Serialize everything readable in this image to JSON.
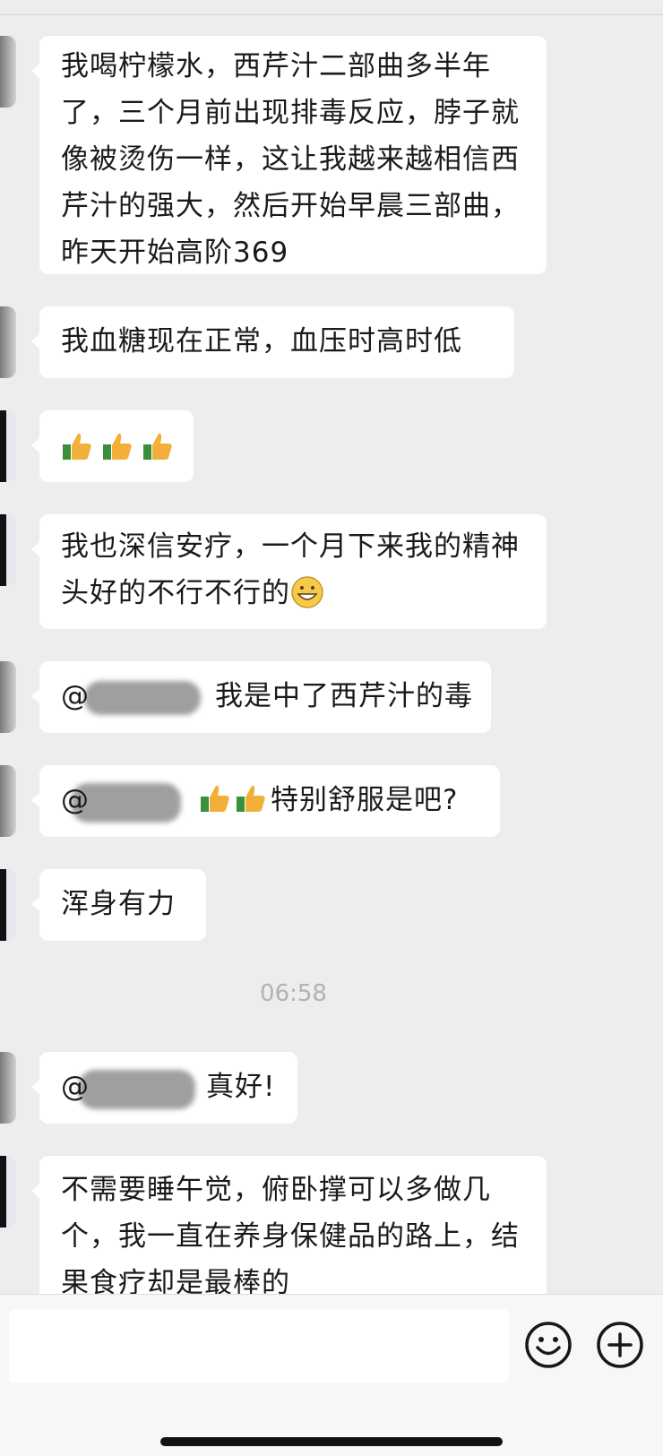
{
  "chat": {
    "messages": [
      {
        "text": "我喝柠檬水，西芹汁二部曲多半年了，三个月前出现排毒反应，脖子就像被烫伤一样，这让我越来越相信西芹汁的强大，然后开始早晨三部曲，昨天开始高阶369"
      },
      {
        "text": "我血糖现在正常，血压时高时低"
      },
      {
        "thumbs": "thumbs-up x3"
      },
      {
        "text": "我也深信安疗，一个月下来我的精神头好的不行不行的",
        "emoji": "grinning-face-icon"
      },
      {
        "prefix": "@",
        "text": "我是中了西芹汁的毒"
      },
      {
        "prefix": "@",
        "text": "特别舒服是吧?"
      },
      {
        "text": "浑身有力"
      },
      {
        "prefix": "@",
        "text": "真好!"
      },
      {
        "text": "不需要睡午觉，俯卧撑可以多做几个，我一直在养身保健品的路上，结果食疗却是最棒的"
      }
    ],
    "timestamp": "06:58"
  },
  "colors": {
    "background": "#ededed",
    "bubble": "#ffffff",
    "text": "#1a1a1a",
    "timestamp": "#b2b2b2"
  },
  "input_bar": {
    "value": "",
    "emoji_button": "smile-icon",
    "plus_button": "plus-icon"
  }
}
